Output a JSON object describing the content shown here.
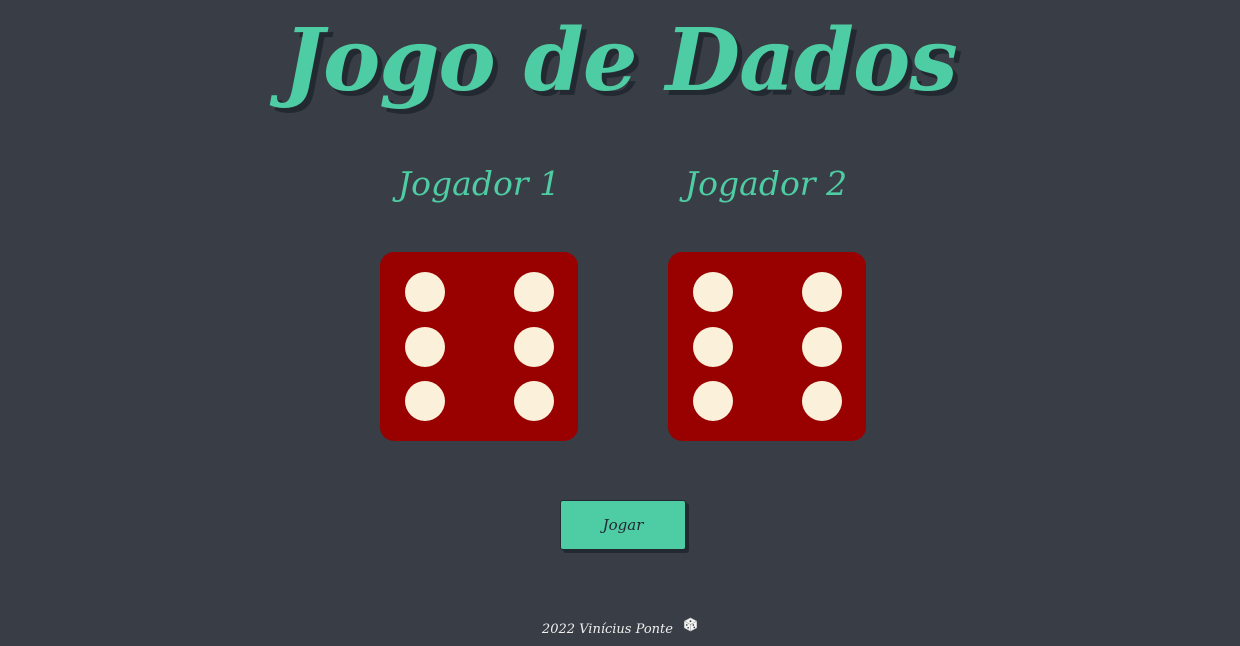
{
  "header": {
    "title": "Jogo de Dados"
  },
  "players": [
    {
      "label": "Jogador 1",
      "dice_value": 6
    },
    {
      "label": "Jogador 2",
      "dice_value": 6
    }
  ],
  "controls": {
    "play_label": "Jogar"
  },
  "footer": {
    "text": "2022 Vinícius Ponte",
    "icon": "dice-icon"
  },
  "colors": {
    "background": "#393e46",
    "accent": "#4ecca3",
    "dice_body": "#990000",
    "dice_pip": "#fbf0da",
    "shadow": "#232931"
  }
}
